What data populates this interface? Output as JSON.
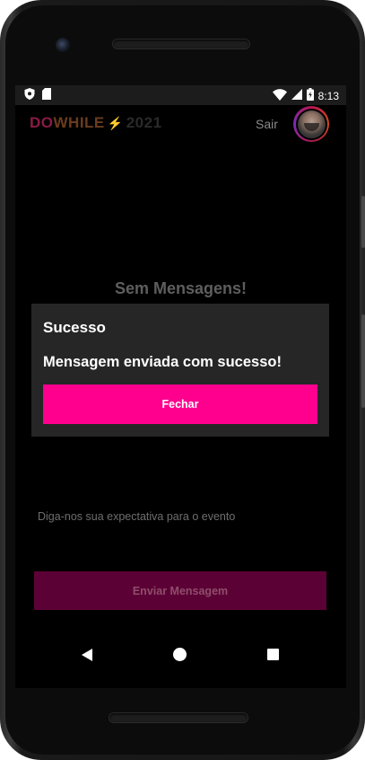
{
  "status_bar": {
    "time": "8:13",
    "icons": [
      "shield-icon",
      "sd-card-icon",
      "wifi-icon",
      "signal-icon",
      "battery-charging-icon"
    ]
  },
  "header": {
    "logo": {
      "part1": "DO",
      "part2": "WHILE",
      "part3": "2021"
    },
    "logout_label": "Sair",
    "avatar": "user-avatar"
  },
  "main": {
    "empty_message": "Sem Mensagens!"
  },
  "dialog": {
    "title": "Sucesso",
    "message": "Mensagem enviada com sucesso!",
    "close_label": "Fechar"
  },
  "composer": {
    "placeholder": "Diga-nos sua expectativa para o evento",
    "send_label": "Enviar Mensagem"
  },
  "nav_bar": {
    "buttons": [
      "back-icon",
      "home-icon",
      "recents-icon"
    ]
  },
  "colors": {
    "accent": "#ff008e",
    "send_button_disabled": "#5c0135",
    "dialog_background": "#262626",
    "screen_background": "#000000"
  }
}
